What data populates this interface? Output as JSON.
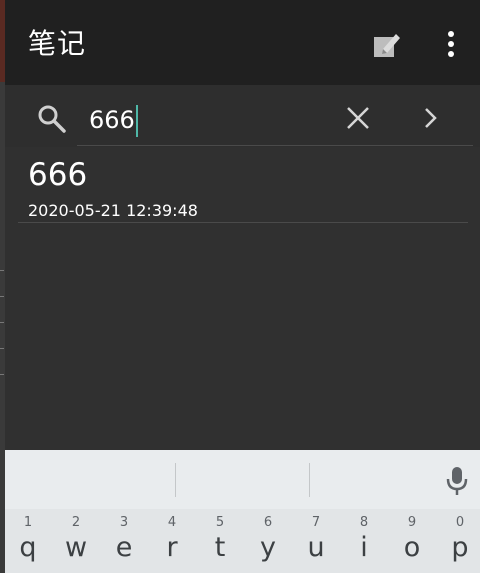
{
  "app_bar": {
    "title": "笔记",
    "actions": [
      "edit-note-icon",
      "more-vert-icon"
    ]
  },
  "search": {
    "value": "666",
    "icons": [
      "search-icon",
      "close-icon",
      "chevron-right-icon"
    ],
    "accent_color": "#4fb8a8"
  },
  "results": [
    {
      "title": "666",
      "timestamp": "2020-05-21 12:39:48"
    }
  ],
  "keyboard": {
    "mic_icon": "mic-icon",
    "row1": [
      {
        "hint": "1",
        "char": "q"
      },
      {
        "hint": "2",
        "char": "w"
      },
      {
        "hint": "3",
        "char": "e"
      },
      {
        "hint": "4",
        "char": "r"
      },
      {
        "hint": "5",
        "char": "t"
      },
      {
        "hint": "6",
        "char": "y"
      },
      {
        "hint": "7",
        "char": "u"
      },
      {
        "hint": "8",
        "char": "i"
      },
      {
        "hint": "9",
        "char": "o"
      },
      {
        "hint": "0",
        "char": "p"
      }
    ]
  },
  "colors": {
    "app_bar": "#202020",
    "background": "#303030",
    "keyboard": "#e7eaeb"
  }
}
